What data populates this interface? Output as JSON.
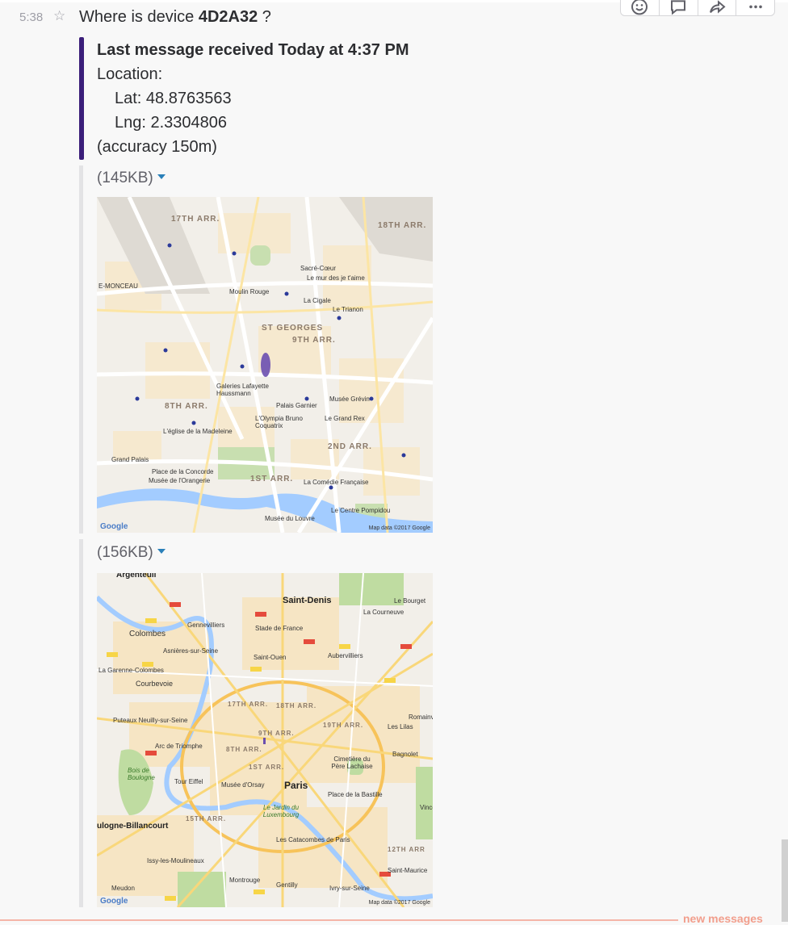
{
  "message": {
    "time": "5:38",
    "text_prefix": "Where is device ",
    "device_id": "4D2A32",
    "text_suffix": " ?"
  },
  "attachment": {
    "title": "Last message received Today at 4:37 PM",
    "location_label": "Location:",
    "lat": "Lat: 48.8763563",
    "lng": "Lng: 2.3304806",
    "accuracy": "(accuracy 150m)"
  },
  "files": [
    {
      "size": "(145KB)",
      "labels": {
        "arr17": "17TH ARR.",
        "arr18": "18TH ARR.",
        "arr9": "9TH ARR.",
        "arr8": "8TH ARR.",
        "arr2": "2ND ARR.",
        "arr1": "1ST ARR.",
        "stgeorges": "ST GEORGES",
        "sacre": "Sacré-Cœur",
        "mur": "Le mur des je t'aime",
        "moulin": "Moulin Rouge",
        "cigale": "La Cigale",
        "trianon": "Le Trianon",
        "galeries": "Galeries Lafayette Haussmann",
        "garnier": "Palais Garnier",
        "grevin": "Musée Grévin",
        "olympia": "L'Olympia Bruno Coquatrix",
        "grandrex": "Le Grand Rex",
        "madeleine": "L'église de la Madeleine",
        "grandpalais": "Grand Palais",
        "concorde": "Place de la Concorde",
        "orangerie": "Musée de l'Orangerie",
        "comedie": "La Comédie Française",
        "pompidou": "Le Centre Pompidou",
        "louvre": "Musée du Louvre",
        "monceau": "E-MONCEAU",
        "google": "Google",
        "mapdata": "Map data ©2017 Google"
      }
    },
    {
      "size": "(156KB)",
      "labels": {
        "argenteuil": "Argenteuil",
        "saintdenis": "Saint-Denis",
        "colombes": "Colombes",
        "gennevilliers": "Gennevilliers",
        "stade": "Stade de France",
        "asnieres": "Asnières-sur-Seine",
        "saintouen": "Saint-Ouen",
        "aubervilliers": "Aubervilliers",
        "garenne": "La Garenne-Colombes",
        "courbevoie": "Courbevoie",
        "puteaux": "Puteaux Neuilly-sur-Seine",
        "arc": "Arc de Triomphe",
        "paris": "Paris",
        "tour": "Tour Eiffel",
        "orsay": "Musée d'Orsay",
        "bastille": "Place de la Bastille",
        "lachaise": "Cimetière du Père Lachaise",
        "bagnolet": "Bagnolet",
        "lilas": "Les Lilas",
        "romainville": "Romainville",
        "catacombes": "Les Catacombes de Paris",
        "billancourt": "ulogne-Billancourt",
        "issy": "Issy-les-Moulineaux",
        "meudon": "Meudon",
        "montrouge": "Montrouge",
        "gentilly": "Gentilly",
        "ivry": "Ivry-sur-Seine",
        "saintmaurice": "Saint-Maurice",
        "vincennes": "Vince",
        "lacourneuve": "La Courneuve",
        "bourget": "Le Bourget",
        "bois": "Bois de Boulogne",
        "luxembourg": "Le Jardin du Luxembourg",
        "arr15": "15TH ARR.",
        "arr12": "12TH ARR",
        "arr19": "19TH ARR.",
        "arr17": "17TH ARR.",
        "arr18": "18TH ARR.",
        "arr9": "9TH ARR.",
        "arr8": "8TH ARR.",
        "arr1": "1ST ARR.",
        "google": "Google",
        "mapdata": "Map data ©2017 Google"
      }
    }
  ],
  "banner": {
    "new_messages": "new messages"
  },
  "colors": {
    "accent_bar": "#3b1e7a",
    "link_caret": "#2a80b9",
    "new_messages": "#f29e8c"
  }
}
